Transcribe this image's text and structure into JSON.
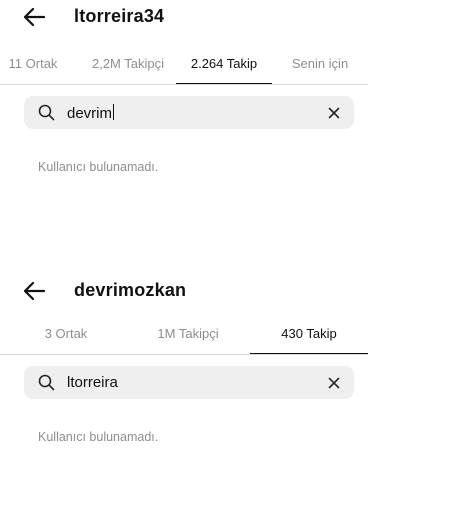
{
  "screens": [
    {
      "title": "ltorreira34",
      "tabs": [
        {
          "label": "11 Ortak",
          "active": false
        },
        {
          "label": "2,2M Takipçi",
          "active": false
        },
        {
          "label": "2.264 Takip",
          "active": true
        },
        {
          "label": "Senin için",
          "active": false
        }
      ],
      "search": {
        "value": "devrim",
        "caret": true
      },
      "empty_message": "Kullanıcı bulunamadı."
    },
    {
      "title": "devrimozkan",
      "tabs": [
        {
          "label": "3 Ortak",
          "active": false
        },
        {
          "label": "1M Takipçi",
          "active": false
        },
        {
          "label": "430 Takip",
          "active": true
        }
      ],
      "search": {
        "value": "ltorreira",
        "caret": false
      },
      "empty_message": "Kullanıcı bulunamadı."
    }
  ],
  "icons": {
    "back": "back-arrow-icon",
    "search": "search-icon",
    "clear": "clear-icon"
  },
  "colors": {
    "active_tab": "#111111",
    "inactive_tab": "#8e8e8e",
    "search_bg": "#efefef",
    "divider": "#dbdbdb"
  }
}
